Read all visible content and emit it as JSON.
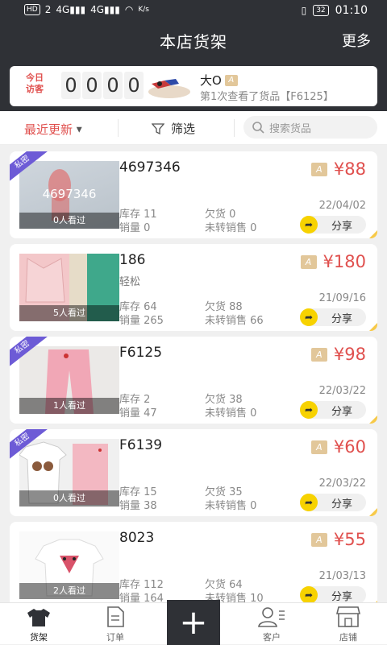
{
  "status_bar": {
    "left": [
      "HD",
      "2",
      "4G",
      "4G",
      "K/s"
    ],
    "battery": "32",
    "time": "01:10"
  },
  "header": {
    "title": "本店货架",
    "more": "更多"
  },
  "visitor": {
    "label": "今日访客",
    "digits": [
      "0",
      "0",
      "0",
      "0"
    ],
    "name": "大O",
    "badge": "A",
    "message": "第1次查看了货品【F6125】"
  },
  "filter": {
    "sort_label": "最近更新",
    "filter_label": "筛选",
    "search_placeholder": "搜索货品"
  },
  "products": [
    {
      "name": "4697346",
      "sub": "",
      "price": "¥88",
      "badge": "A",
      "stock_label": "库存 11",
      "sold_label": "销量 0",
      "owe_label": "欠货 0",
      "unsold_label": "未转销售 0",
      "date": "22/04/02",
      "views": "0人看过",
      "private": "私密",
      "overlay": "4697346",
      "share": "分享"
    },
    {
      "name": "186",
      "sub": "轻松",
      "price": "¥180",
      "badge": "A",
      "stock_label": "库存 64",
      "sold_label": "销量 265",
      "owe_label": "欠货 88",
      "unsold_label": "未转销售 66",
      "date": "21/09/16",
      "views": "5人看过",
      "private": "",
      "overlay": "",
      "share": "分享"
    },
    {
      "name": "F6125",
      "sub": "",
      "price": "¥98",
      "badge": "A",
      "stock_label": "库存 2",
      "sold_label": "销量 47",
      "owe_label": "欠货 38",
      "unsold_label": "未转销售 0",
      "date": "22/03/22",
      "views": "1人看过",
      "private": "私密",
      "overlay": "",
      "share": "分享"
    },
    {
      "name": "F6139",
      "sub": "",
      "price": "¥60",
      "badge": "A",
      "stock_label": "库存 15",
      "sold_label": "销量 38",
      "owe_label": "欠货 35",
      "unsold_label": "未转销售 0",
      "date": "22/03/22",
      "views": "0人看过",
      "private": "私密",
      "overlay": "",
      "share": "分享"
    },
    {
      "name": "8023",
      "sub": "",
      "price": "¥55",
      "badge": "A",
      "stock_label": "库存 112",
      "sold_label": "销量 164",
      "owe_label": "欠货 64",
      "unsold_label": "未转销售 10",
      "date": "21/03/13",
      "views": "2人看过",
      "private": "",
      "overlay": "",
      "share": "分享"
    }
  ],
  "tabbar": {
    "shelf": "货架",
    "orders": "订单",
    "add": "+",
    "customers": "客户",
    "store": "店铺"
  },
  "colors": {
    "accent": "#e0504e",
    "dark": "#2f3136",
    "share_yellow": "#f7d200",
    "private_purple": "#6d5bd6"
  }
}
